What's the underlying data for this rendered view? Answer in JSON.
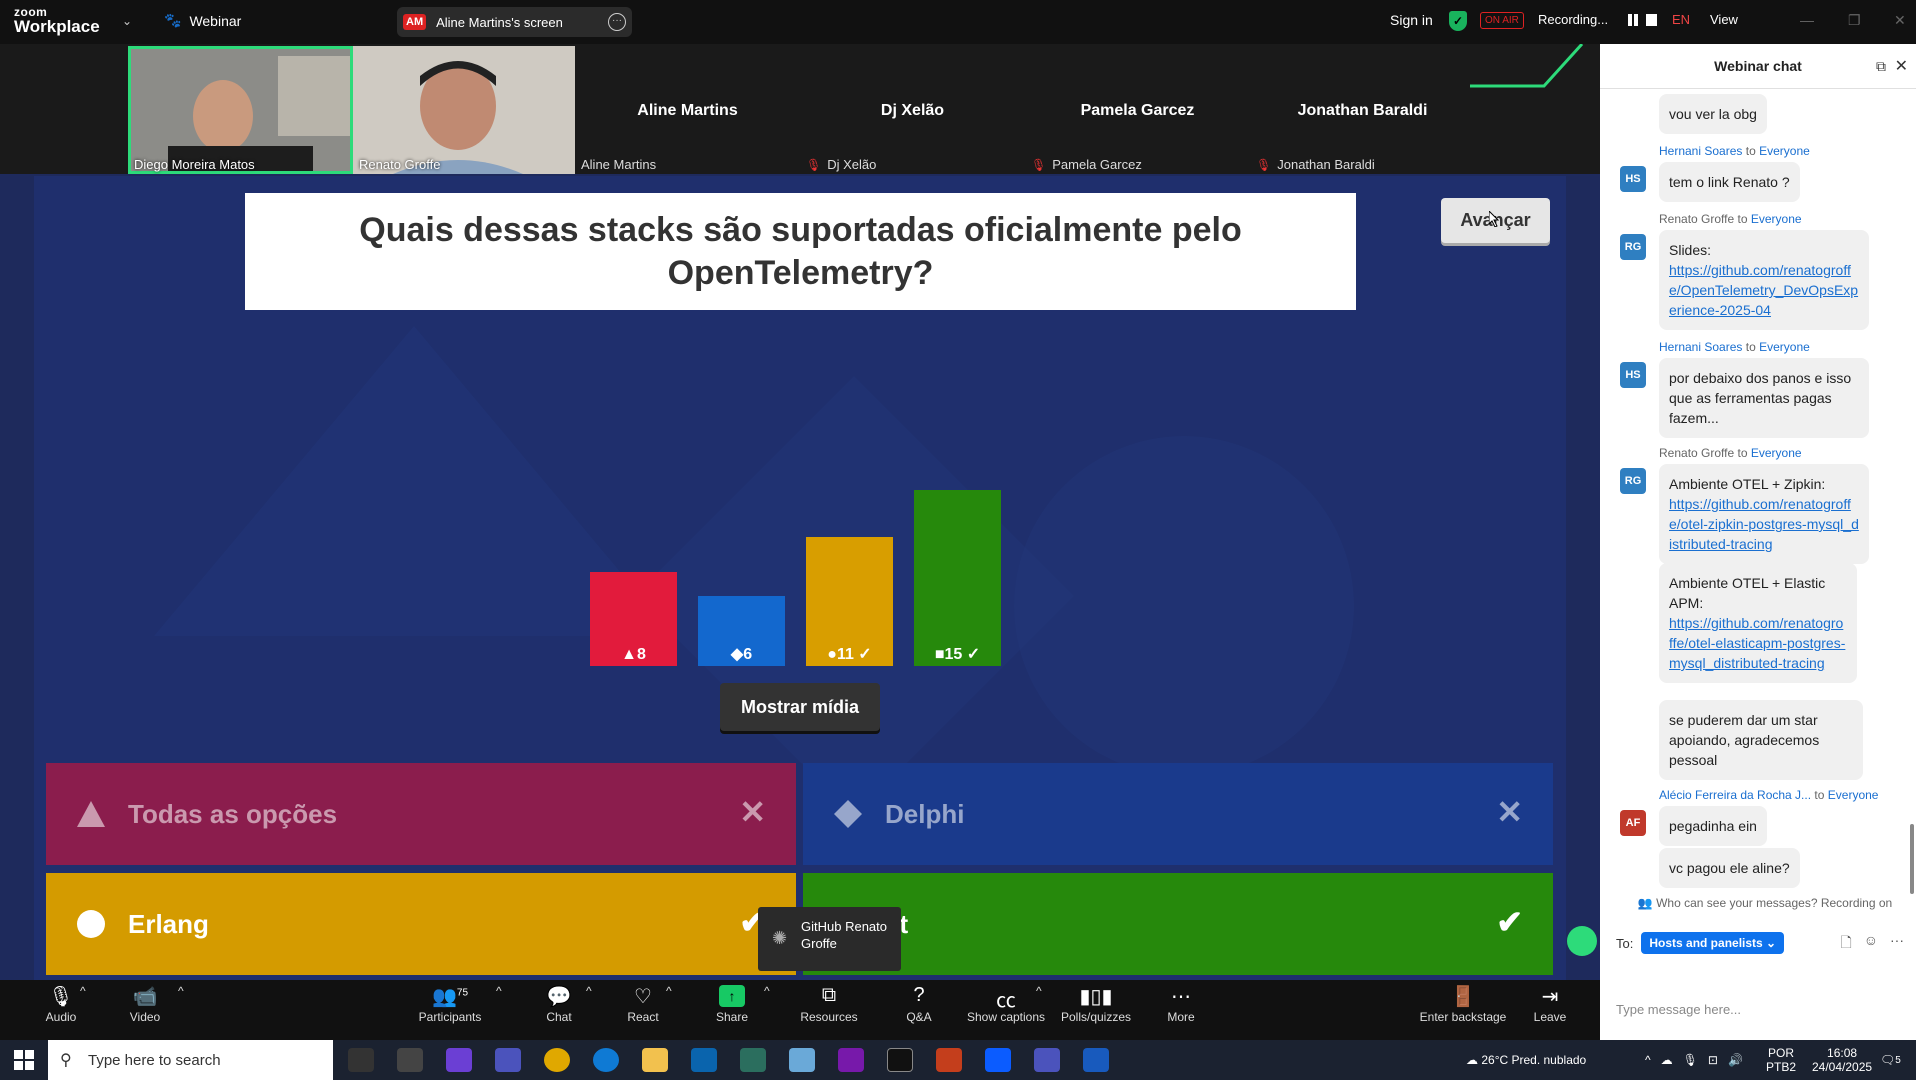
{
  "topbar": {
    "logo_top": "zoom",
    "logo_bottom": "Workplace",
    "webinar_label": "Webinar",
    "screen_badge": "AM",
    "screen_label": "Aline Martins's screen",
    "sign_in": "Sign in",
    "on_air": "ON AIR",
    "recording": "Recording...",
    "lang": "EN",
    "view": "View"
  },
  "participants": [
    {
      "name": "Diego Moreira Matos",
      "video": true,
      "active": true
    },
    {
      "name": "Renato Groffe",
      "video": true,
      "active": false
    },
    {
      "name": "Aline Martins",
      "label": "Aline Martins",
      "video": false,
      "muted": false
    },
    {
      "name": "Dj Xelão",
      "label": "Dj Xelão",
      "video": false,
      "muted": true
    },
    {
      "name": "Pamela Garcez",
      "label": "Pamela Garcez",
      "video": false,
      "muted": true
    },
    {
      "name": "Jonathan Baraldi",
      "label": "Jonathan Baraldi",
      "video": false,
      "muted": true
    }
  ],
  "quiz": {
    "question": "Quais dessas stacks são suportadas oficialmente pelo OpenTelemetry?",
    "next_button": "Avançar",
    "show_media_button": "Mostrar mídia",
    "answers": [
      {
        "text": "Todas as opções",
        "correct": false,
        "mark": "✕",
        "symbol": "triangle"
      },
      {
        "text": "Delphi",
        "correct": false,
        "mark": "✕",
        "symbol": "diamond"
      },
      {
        "text": "Erlang",
        "correct": true,
        "mark": "✔",
        "symbol": "circle"
      },
      {
        "text": "st",
        "correct": true,
        "mark": "✔",
        "symbol": "square"
      }
    ],
    "tooltip": "GitHub Renato Groffe"
  },
  "chart_data": {
    "type": "bar",
    "categories": [
      "triangle",
      "diamond",
      "circle",
      "square"
    ],
    "values": [
      8,
      6,
      11,
      15
    ],
    "labels": [
      "▲8",
      "◆6",
      "●11 ✓",
      "■15 ✓"
    ],
    "colors": [
      "#e21b3c",
      "#1368ce",
      "#d89e00",
      "#26890c"
    ]
  },
  "chat": {
    "title": "Webinar chat",
    "messages": [
      {
        "text": "vou ver la obg"
      },
      {
        "sender": "Hernani Soares",
        "to_word": "to",
        "to": "Everyone",
        "initials": "HS",
        "text": "tem o link Renato ?"
      },
      {
        "sender": "Renato Groffe",
        "to_word": "to",
        "to": "Everyone",
        "initials": "RG",
        "text": "Slides:",
        "link": "https://github.com/renatogroffe/OpenTelemetry_DevOpsExperience-2025-04"
      },
      {
        "sender": "Hernani Soares",
        "to_word": "to",
        "to": "Everyone",
        "initials": "HS",
        "text": "por debaixo dos panos e isso que as ferramentas pagas fazem..."
      },
      {
        "sender": "Renato Groffe",
        "to_word": "to",
        "to": "Everyone",
        "initials": "RG",
        "text": "Ambiente OTEL + Zipkin:",
        "link": "https://github.com/renatogroffe/otel-zipkin-postgres-mysql_distributed-tracing"
      },
      {
        "text": "Ambiente OTEL + Elastic APM:",
        "link": "https://github.com/renatogroffe/otel-elasticapm-postgres-mysql_distributed-tracing"
      },
      {
        "text": "se puderem dar um star apoiando, agradecemos pessoal"
      },
      {
        "sender": "Alécio Ferreira da Rocha J...",
        "to_word": "to",
        "to": "Everyone",
        "initials": "AF",
        "text": "pegadinha ein"
      },
      {
        "text": "vc pagou ele aline?"
      }
    ],
    "notice": "Who can see your messages? Recording on",
    "to_label": "To:",
    "to_value": "Hosts and panelists",
    "input_placeholder": "Type message here..."
  },
  "toolbar": {
    "audio": "Audio",
    "video": "Video",
    "participants": "Participants",
    "participants_count": "75",
    "chat": "Chat",
    "react": "React",
    "share": "Share",
    "resources": "Resources",
    "qa": "Q&A",
    "captions": "Show captions",
    "polls": "Polls/quizzes",
    "more": "More",
    "backstage": "Enter backstage",
    "leave": "Leave"
  },
  "taskbar": {
    "search_placeholder": "Type here to search",
    "weather": "26°C  Pred. nublado",
    "lang1": "POR",
    "lang2": "PTB2",
    "time": "16:08",
    "date": "24/04/2025",
    "notif_count": "5"
  }
}
